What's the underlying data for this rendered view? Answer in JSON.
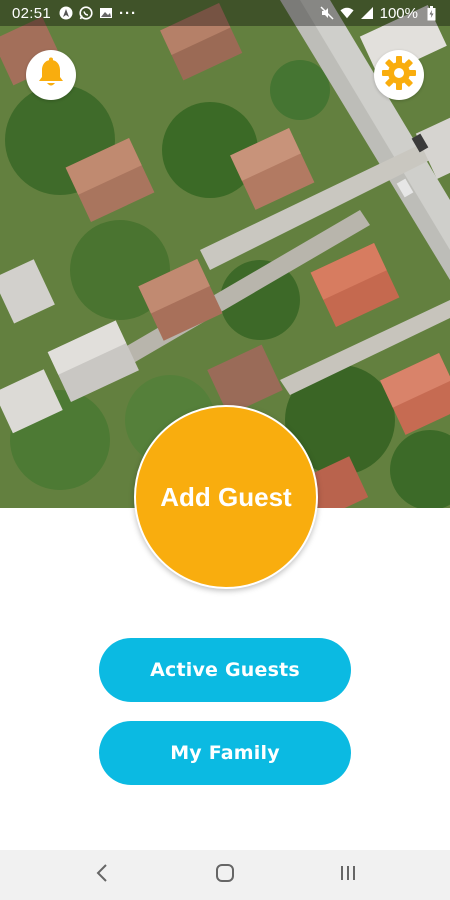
{
  "status_bar": {
    "time": "02:51",
    "battery": "100%",
    "icons": [
      "navigation-a-icon",
      "whatsapp-icon",
      "gallery-icon",
      "more-dots-icon",
      "mute-icon",
      "wifi-icon",
      "signal-icon",
      "battery-icon"
    ],
    "more_dots": "···"
  },
  "header": {
    "left_icon": "bell-icon",
    "right_icon": "gear-icon",
    "accent_color": "#f9ad0e"
  },
  "main": {
    "add_guest_label": "Add Guest",
    "add_guest_color": "#f9ad0e",
    "buttons": [
      {
        "label": "Active Guests"
      },
      {
        "label": "My Family"
      }
    ],
    "button_color": "#0bbae2"
  },
  "nav_bar": {
    "items": [
      "back-icon",
      "home-icon",
      "recents-icon"
    ]
  }
}
